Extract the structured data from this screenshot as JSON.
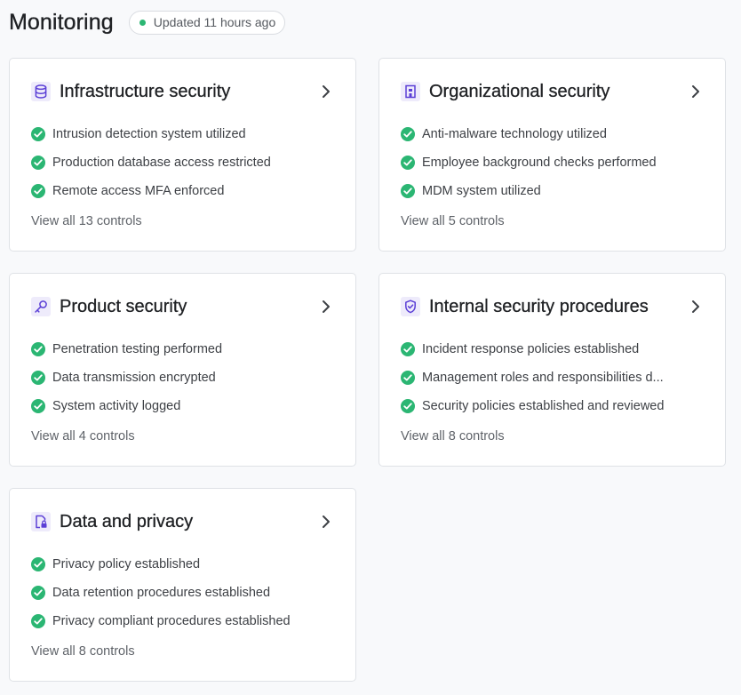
{
  "header": {
    "title": "Monitoring",
    "updated_text": "Updated 11 hours ago"
  },
  "colors": {
    "accent": "#5b3fd6",
    "icon_bg": "#eeebfb",
    "success": "#2bb673"
  },
  "cards": [
    {
      "icon": "database-icon",
      "title": "Infrastructure security",
      "items": [
        "Intrusion detection system utilized",
        "Production database access restricted",
        "Remote access MFA enforced"
      ],
      "view_all": "View all 13 controls"
    },
    {
      "icon": "building-icon",
      "title": "Organizational security",
      "items": [
        "Anti-malware technology utilized",
        "Employee background checks performed",
        "MDM system utilized"
      ],
      "view_all": "View all 5 controls"
    },
    {
      "icon": "key-icon",
      "title": "Product security",
      "items": [
        "Penetration testing performed",
        "Data transmission encrypted",
        "System activity logged"
      ],
      "view_all": "View all 4 controls"
    },
    {
      "icon": "shield-check-icon",
      "title": "Internal security procedures",
      "items": [
        "Incident response policies established",
        "Management roles and responsibilities d...",
        "Security policies established and reviewed"
      ],
      "view_all": "View all 8 controls"
    },
    {
      "icon": "file-lock-icon",
      "title": "Data and privacy",
      "items": [
        "Privacy policy established",
        "Data retention procedures established",
        "Privacy compliant procedures established"
      ],
      "view_all": "View all 8 controls"
    }
  ]
}
